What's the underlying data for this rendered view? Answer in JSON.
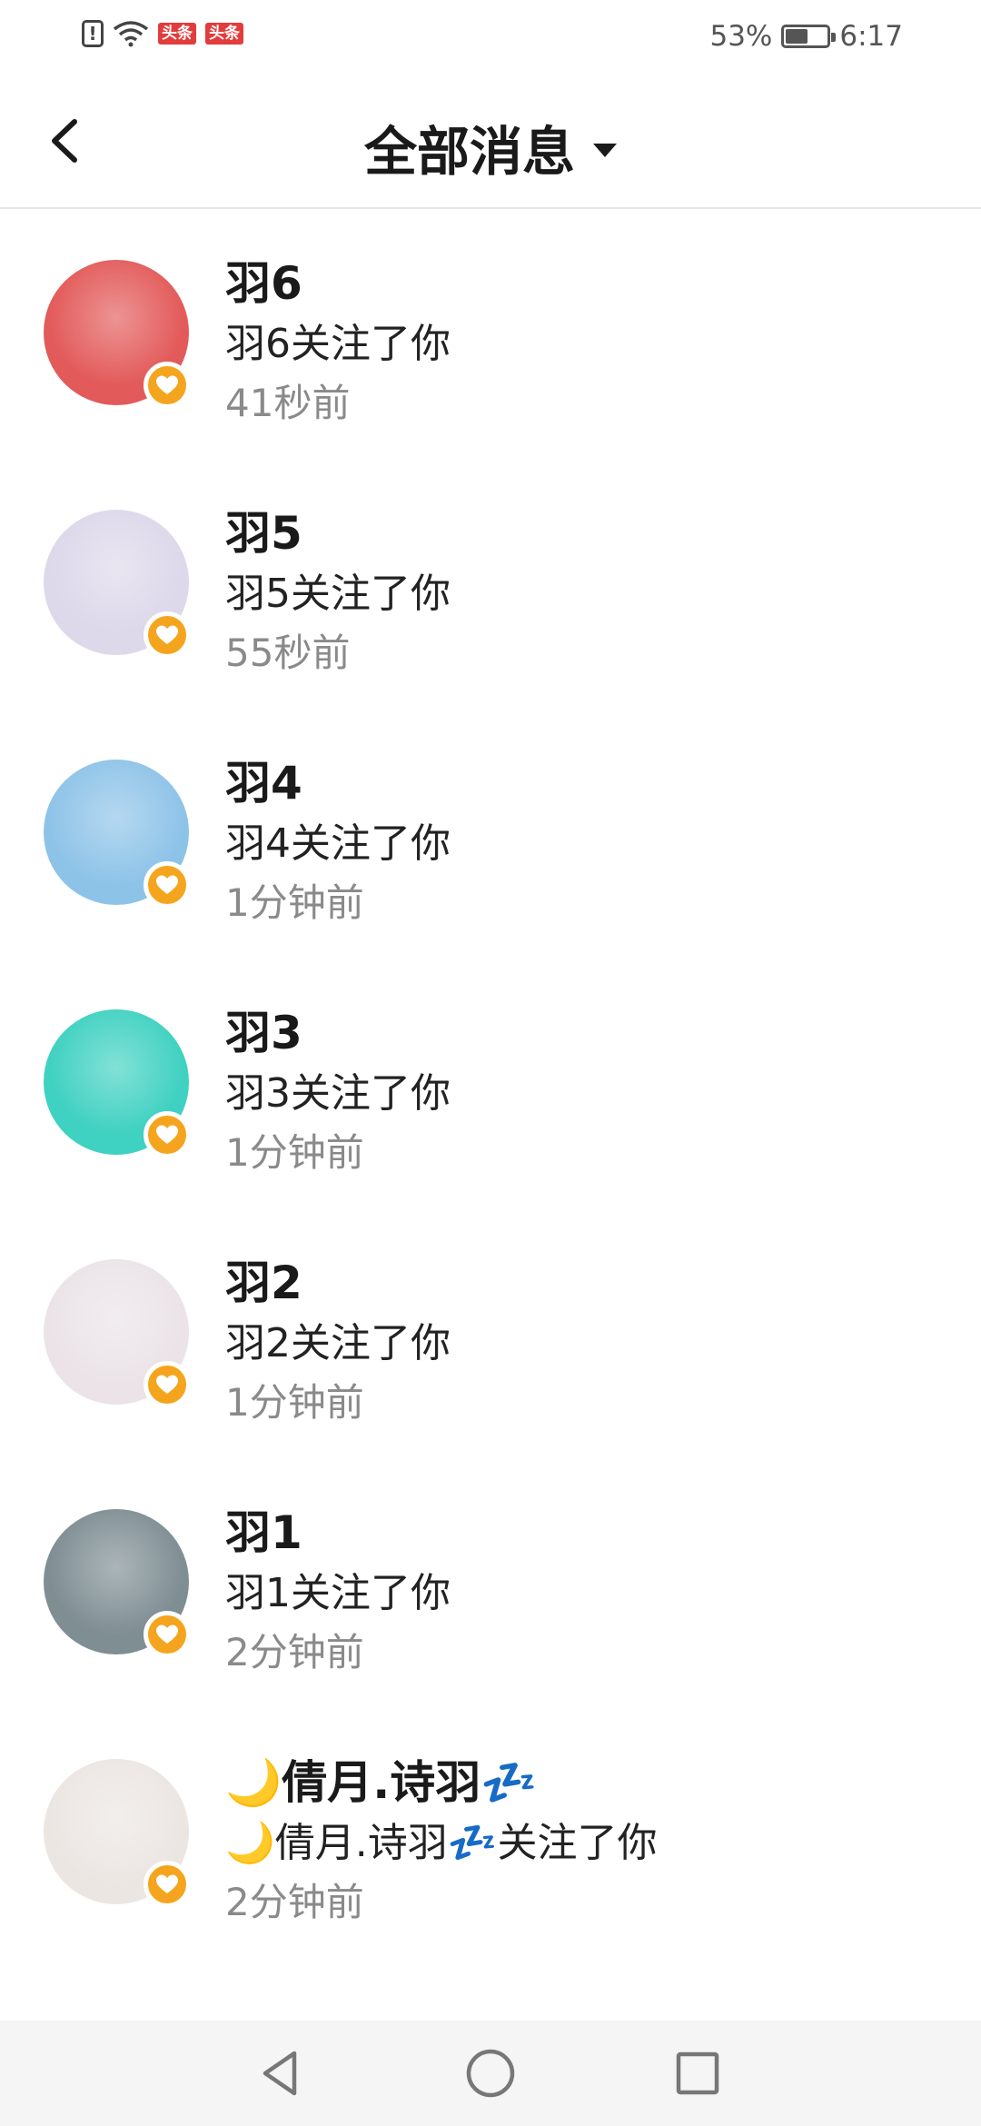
{
  "status_bar": {
    "badge_1": "头条",
    "badge_2": "头条",
    "battery_percent": "53%",
    "battery_level": 0.53,
    "time": "6:17"
  },
  "header": {
    "title": "全部消息",
    "dropdown_icon": "caret-down-icon",
    "back_icon": "chevron-left-icon"
  },
  "notifications": [
    {
      "name": "羽6",
      "message": "羽6关注了你",
      "time": "41秒前",
      "avatar_color": "#e35a5a"
    },
    {
      "name": "羽5",
      "message": "羽5关注了你",
      "time": "55秒前",
      "avatar_color": "#ddd8ea"
    },
    {
      "name": "羽4",
      "message": "羽4关注了你",
      "time": "1分钟前",
      "avatar_color": "#8ec3e8"
    },
    {
      "name": "羽3",
      "message": "羽3关注了你",
      "time": "1分钟前",
      "avatar_color": "#3fd1c1"
    },
    {
      "name": "羽2",
      "message": "羽2关注了你",
      "time": "1分钟前",
      "avatar_color": "#ebe3e8"
    },
    {
      "name": "羽1",
      "message": "羽1关注了你",
      "time": "2分钟前",
      "avatar_color": "#7f8e93"
    },
    {
      "name": "🌙倩月.诗羽💤",
      "message": "🌙倩月.诗羽💤关注了你",
      "time": "2分钟前",
      "avatar_color": "#ece6e3"
    }
  ],
  "colors": {
    "accent_badge": "#f5a51d",
    "secondary_text": "#8a8a8a"
  },
  "nav": {
    "back": "triangle-back-icon",
    "home": "circle-home-icon",
    "recents": "square-recents-icon"
  }
}
